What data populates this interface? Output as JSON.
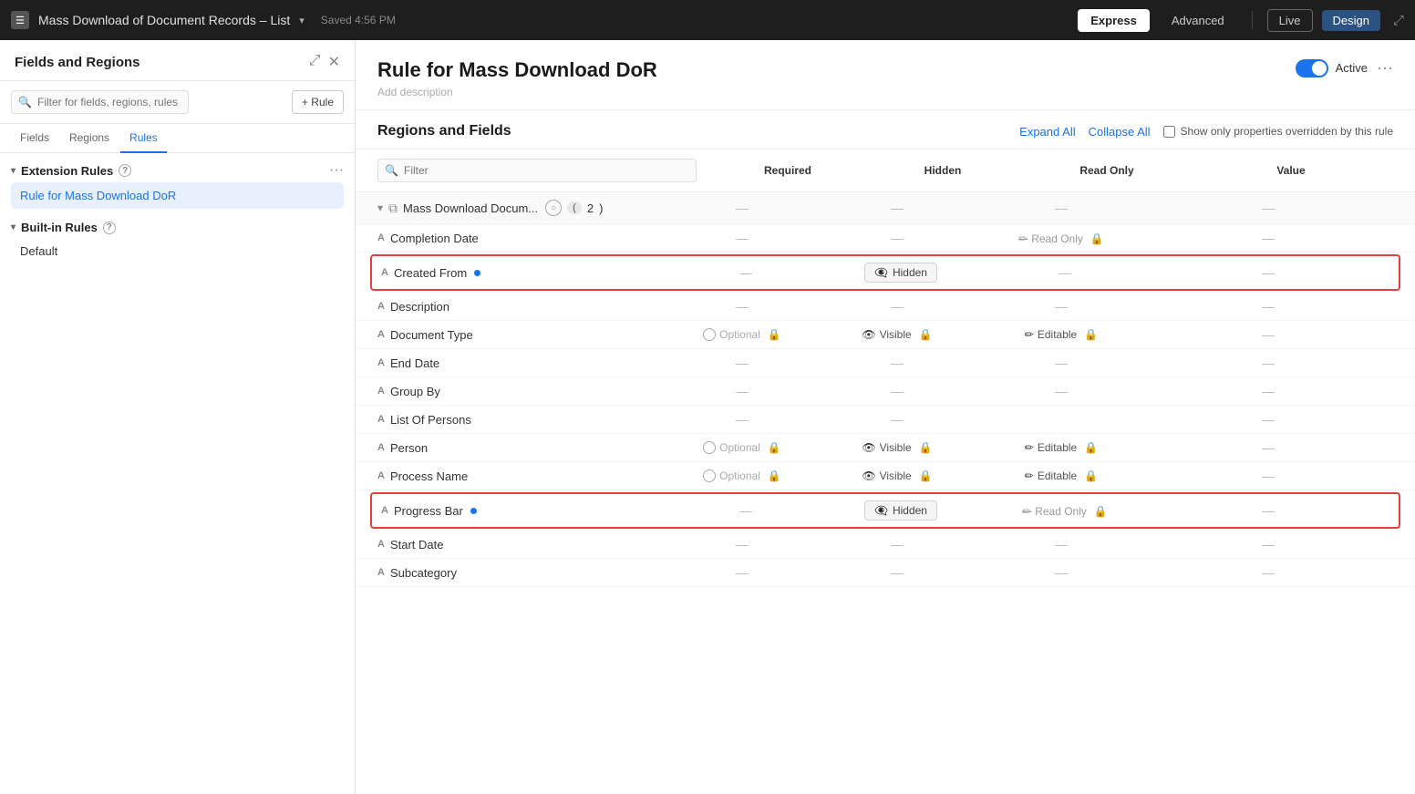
{
  "topbar": {
    "doc_title": "Mass Download of Document Records – List",
    "saved_text": "Saved 4:56 PM",
    "btn_express": "Express",
    "btn_advanced": "Advanced",
    "btn_live": "Live",
    "btn_design": "Design"
  },
  "sidebar": {
    "title": "Fields and Regions",
    "search_placeholder": "Filter for fields, regions, rules",
    "add_rule_label": "+ Rule",
    "tabs": [
      "Fields",
      "Regions",
      "Rules"
    ],
    "active_tab": "Rules",
    "extension_rules_label": "Extension Rules",
    "extension_rule_item": "Rule for Mass Download DoR",
    "built_in_rules_label": "Built-in Rules",
    "built_in_item": "Default"
  },
  "rule": {
    "title": "Rule for Mass Download DoR",
    "add_description": "Add description",
    "active_label": "Active",
    "regions_fields_title": "Regions and Fields",
    "expand_all": "Expand All",
    "collapse_all": "Collapse All",
    "show_only_label": "Show only properties overridden by this rule",
    "filter_placeholder": "Filter",
    "col_required": "Required",
    "col_hidden": "Hidden",
    "col_readonly": "Read Only",
    "col_value": "Value",
    "region_name": "Mass Download Docum...",
    "region_count": "2"
  },
  "fields": [
    {
      "name": "Completion Date",
      "type": "A",
      "required": "—",
      "hidden": "—",
      "readonly": "Read Only",
      "readonly_locked": true,
      "value": "—",
      "dot": false,
      "highlighted": false
    },
    {
      "name": "Created From",
      "type": "A",
      "required": "—",
      "hidden": "Hidden",
      "hidden_pill": true,
      "readonly": "—",
      "value": "—",
      "dot": true,
      "highlighted": true
    },
    {
      "name": "Description",
      "type": "A",
      "required": "—",
      "hidden": "—",
      "readonly": "—",
      "value": "—",
      "dot": false,
      "highlighted": false
    },
    {
      "name": "Document Type",
      "type": "A",
      "required": "Optional",
      "required_lock": true,
      "hidden": "Visible",
      "hidden_lock": true,
      "readonly": "Editable",
      "readonly_lock": true,
      "value": "—",
      "dot": false,
      "highlighted": false
    },
    {
      "name": "End Date",
      "type": "A",
      "required": "—",
      "hidden": "—",
      "readonly": "—",
      "value": "—",
      "dot": false,
      "highlighted": false
    },
    {
      "name": "Group By",
      "type": "A",
      "required": "—",
      "hidden": "—",
      "readonly": "—",
      "value": "—",
      "dot": false,
      "highlighted": false
    },
    {
      "name": "List Of Persons",
      "type": "A",
      "required": "—",
      "hidden": "—",
      "readonly": "—",
      "value": "—",
      "dot": false,
      "highlighted": false
    },
    {
      "name": "Person",
      "type": "A",
      "required": "Optional",
      "required_lock": true,
      "hidden": "Visible",
      "hidden_lock": true,
      "readonly": "Editable",
      "readonly_lock": true,
      "value": "—",
      "dot": false,
      "highlighted": false
    },
    {
      "name": "Process Name",
      "type": "A",
      "required": "Optional",
      "required_lock": true,
      "hidden": "Visible",
      "hidden_lock": true,
      "readonly": "Editable",
      "readonly_lock": true,
      "value": "—",
      "dot": false,
      "highlighted": false
    },
    {
      "name": "Progress Bar",
      "type": "A",
      "required": "—",
      "hidden": "Hidden",
      "hidden_pill": true,
      "readonly": "Read Only",
      "readonly_locked": true,
      "value": "—",
      "dot": true,
      "highlighted": true
    },
    {
      "name": "Start Date",
      "type": "A",
      "required": "—",
      "hidden": "—",
      "readonly": "—",
      "value": "—",
      "dot": false,
      "highlighted": false
    },
    {
      "name": "Subcategory",
      "type": "A",
      "required": "—",
      "hidden": "—",
      "readonly": "—",
      "value": "—",
      "dot": false,
      "highlighted": false
    }
  ]
}
